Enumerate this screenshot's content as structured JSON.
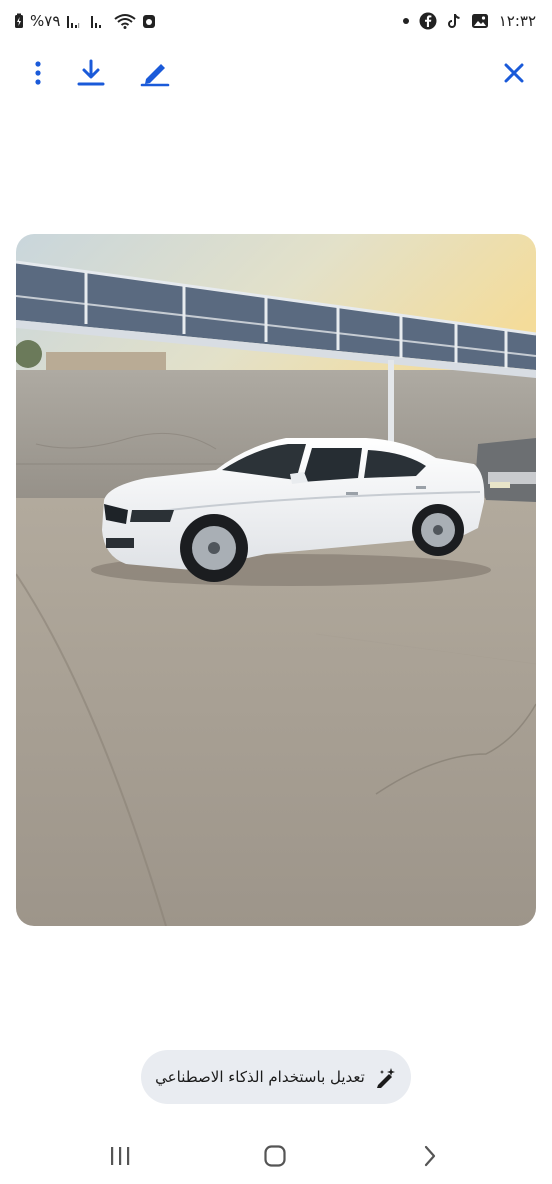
{
  "status_bar": {
    "time": "١٢:٣٢",
    "battery": "%٧٩",
    "notifications": [
      "photos-icon",
      "tiktok-icon",
      "facebook-icon"
    ]
  },
  "toolbar": {
    "accent": "#1a5ad9",
    "buttons": [
      "more-options",
      "download",
      "edit",
      "close"
    ]
  },
  "photo": {
    "subject": "white sedan under a carport"
  },
  "ai_edit": {
    "label": "تعديل باستخدام الذكاء الاصطناعي"
  },
  "nav": {
    "buttons": [
      "recent-apps",
      "home",
      "back"
    ]
  }
}
